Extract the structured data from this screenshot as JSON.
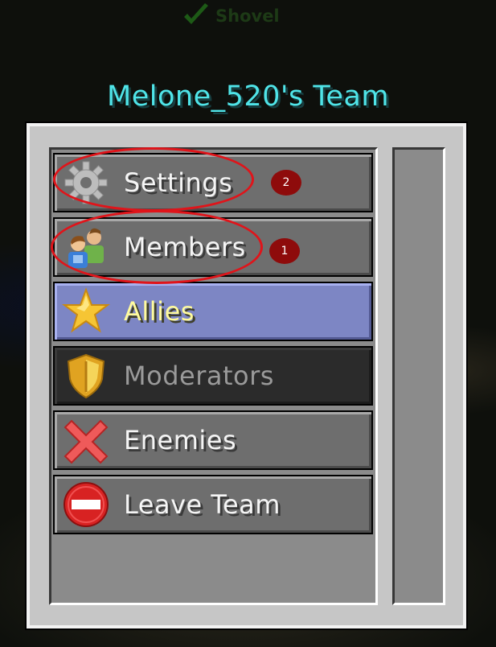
{
  "hud": {
    "held_item_label": "Shovel",
    "check_icon": "check-icon",
    "check_color": "#1d5a16"
  },
  "team_title": "Melone_520's Team",
  "menu": {
    "items": [
      {
        "label": "Settings",
        "icon": "gear-icon",
        "state": "normal"
      },
      {
        "label": "Members",
        "icon": "members-icon",
        "state": "normal"
      },
      {
        "label": "Allies",
        "icon": "star-icon",
        "state": "selected"
      },
      {
        "label": "Moderators",
        "icon": "shield-icon",
        "state": "disabled"
      },
      {
        "label": "Enemies",
        "icon": "red-x-icon",
        "state": "normal"
      },
      {
        "label": "Leave Team",
        "icon": "no-entry-icon",
        "state": "normal"
      }
    ]
  },
  "annotations": {
    "settings_number": "2",
    "members_number": "1",
    "highlight_color": "#e0141a"
  },
  "colors": {
    "title": "#4fe4e8",
    "selected_bg": "#7d86c4",
    "selected_text": "#fffb9e",
    "disabled_text": "#9a9a9a"
  }
}
